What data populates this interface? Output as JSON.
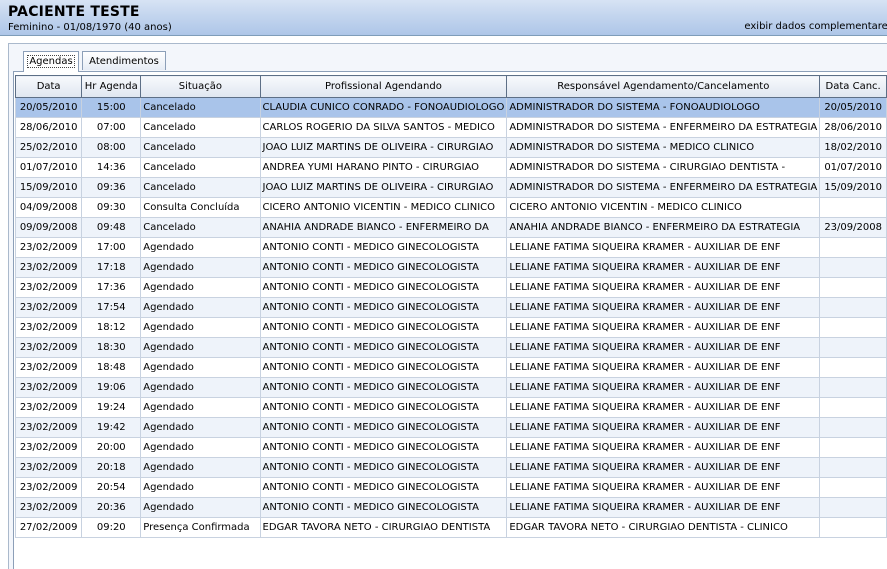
{
  "header": {
    "patient_name": "PACIENTE TESTE",
    "patient_info": "Feminino - 01/08/1970 (40 anos)",
    "details_link": "exibir dados complementares"
  },
  "tabs": [
    {
      "label": "Agendas",
      "active": true
    },
    {
      "label": "Atendimentos",
      "active": false
    }
  ],
  "table": {
    "columns": [
      "Data",
      "Hr Agenda",
      "Situação",
      "Profissional Agendando",
      "Responsável Agendamento/Cancelamento",
      "Data Canc."
    ],
    "rows": [
      [
        "20/05/2010",
        "15:00",
        "Cancelado",
        "CLAUDIA CUNICO CONRADO - FONOAUDIOLOGO",
        "ADMINISTRADOR DO SISTEMA - FONOAUDIOLOGO",
        "20/05/2010"
      ],
      [
        "28/06/2010",
        "07:00",
        "Cancelado",
        "CARLOS ROGERIO DA SILVA SANTOS - MEDICO",
        "ADMINISTRADOR DO SISTEMA - ENFERMEIRO DA ESTRATEGIA",
        "28/06/2010"
      ],
      [
        "25/02/2010",
        "08:00",
        "Cancelado",
        "JOAO LUIZ MARTINS DE OLIVEIRA - CIRURGIAO",
        "ADMINISTRADOR DO SISTEMA - MEDICO CLINICO",
        "18/02/2010"
      ],
      [
        "01/07/2010",
        "14:36",
        "Cancelado",
        "ANDREA YUMI HARANO PINTO - CIRURGIAO",
        "ADMINISTRADOR DO SISTEMA - CIRURGIAO DENTISTA -",
        "01/07/2010"
      ],
      [
        "15/09/2010",
        "09:36",
        "Cancelado",
        "JOAO LUIZ MARTINS DE OLIVEIRA - CIRURGIAO",
        "ADMINISTRADOR DO SISTEMA - ENFERMEIRO DA ESTRATEGIA",
        "15/09/2010"
      ],
      [
        "04/09/2008",
        "09:30",
        "Consulta Concluída",
        "CICERO ANTONIO VICENTIN - MEDICO CLINICO",
        "CICERO ANTONIO VICENTIN - MEDICO CLINICO",
        ""
      ],
      [
        "09/09/2008",
        "09:48",
        "Cancelado",
        "ANAHIA ANDRADE BIANCO - ENFERMEIRO DA",
        "ANAHIA ANDRADE BIANCO - ENFERMEIRO DA ESTRATEGIA",
        "23/09/2008"
      ],
      [
        "23/02/2009",
        "17:00",
        "Agendado",
        "ANTONIO CONTI - MEDICO GINECOLOGISTA",
        "LELIANE FATIMA SIQUEIRA KRAMER - AUXILIAR DE ENF",
        ""
      ],
      [
        "23/02/2009",
        "17:18",
        "Agendado",
        "ANTONIO CONTI - MEDICO GINECOLOGISTA",
        "LELIANE FATIMA SIQUEIRA KRAMER - AUXILIAR DE ENF",
        ""
      ],
      [
        "23/02/2009",
        "17:36",
        "Agendado",
        "ANTONIO CONTI - MEDICO GINECOLOGISTA",
        "LELIANE FATIMA SIQUEIRA KRAMER - AUXILIAR DE ENF",
        ""
      ],
      [
        "23/02/2009",
        "17:54",
        "Agendado",
        "ANTONIO CONTI - MEDICO GINECOLOGISTA",
        "LELIANE FATIMA SIQUEIRA KRAMER - AUXILIAR DE ENF",
        ""
      ],
      [
        "23/02/2009",
        "18:12",
        "Agendado",
        "ANTONIO CONTI - MEDICO GINECOLOGISTA",
        "LELIANE FATIMA SIQUEIRA KRAMER - AUXILIAR DE ENF",
        ""
      ],
      [
        "23/02/2009",
        "18:30",
        "Agendado",
        "ANTONIO CONTI - MEDICO GINECOLOGISTA",
        "LELIANE FATIMA SIQUEIRA KRAMER - AUXILIAR DE ENF",
        ""
      ],
      [
        "23/02/2009",
        "18:48",
        "Agendado",
        "ANTONIO CONTI - MEDICO GINECOLOGISTA",
        "LELIANE FATIMA SIQUEIRA KRAMER - AUXILIAR DE ENF",
        ""
      ],
      [
        "23/02/2009",
        "19:06",
        "Agendado",
        "ANTONIO CONTI - MEDICO GINECOLOGISTA",
        "LELIANE FATIMA SIQUEIRA KRAMER - AUXILIAR DE ENF",
        ""
      ],
      [
        "23/02/2009",
        "19:24",
        "Agendado",
        "ANTONIO CONTI - MEDICO GINECOLOGISTA",
        "LELIANE FATIMA SIQUEIRA KRAMER - AUXILIAR DE ENF",
        ""
      ],
      [
        "23/02/2009",
        "19:42",
        "Agendado",
        "ANTONIO CONTI - MEDICO GINECOLOGISTA",
        "LELIANE FATIMA SIQUEIRA KRAMER - AUXILIAR DE ENF",
        ""
      ],
      [
        "23/02/2009",
        "20:00",
        "Agendado",
        "ANTONIO CONTI - MEDICO GINECOLOGISTA",
        "LELIANE FATIMA SIQUEIRA KRAMER - AUXILIAR DE ENF",
        ""
      ],
      [
        "23/02/2009",
        "20:18",
        "Agendado",
        "ANTONIO CONTI - MEDICO GINECOLOGISTA",
        "LELIANE FATIMA SIQUEIRA KRAMER - AUXILIAR DE ENF",
        ""
      ],
      [
        "23/02/2009",
        "20:54",
        "Agendado",
        "ANTONIO CONTI - MEDICO GINECOLOGISTA",
        "LELIANE FATIMA SIQUEIRA KRAMER - AUXILIAR DE ENF",
        ""
      ],
      [
        "23/02/2009",
        "20:36",
        "Agendado",
        "ANTONIO CONTI - MEDICO GINECOLOGISTA",
        "LELIANE FATIMA SIQUEIRA KRAMER - AUXILIAR DE ENF",
        ""
      ],
      [
        "27/02/2009",
        "09:20",
        "Presença Confirmada",
        "EDGAR TAVORA NETO - CIRURGIAO DENTISTA",
        "EDGAR TAVORA NETO - CIRURGIAO DENTISTA - CLINICO",
        ""
      ]
    ],
    "selected_row": 0
  },
  "colors": {
    "header_bg": "#c3d5ee",
    "selected_row": "#a9c4ea",
    "alt_row": "#eef3fa"
  }
}
